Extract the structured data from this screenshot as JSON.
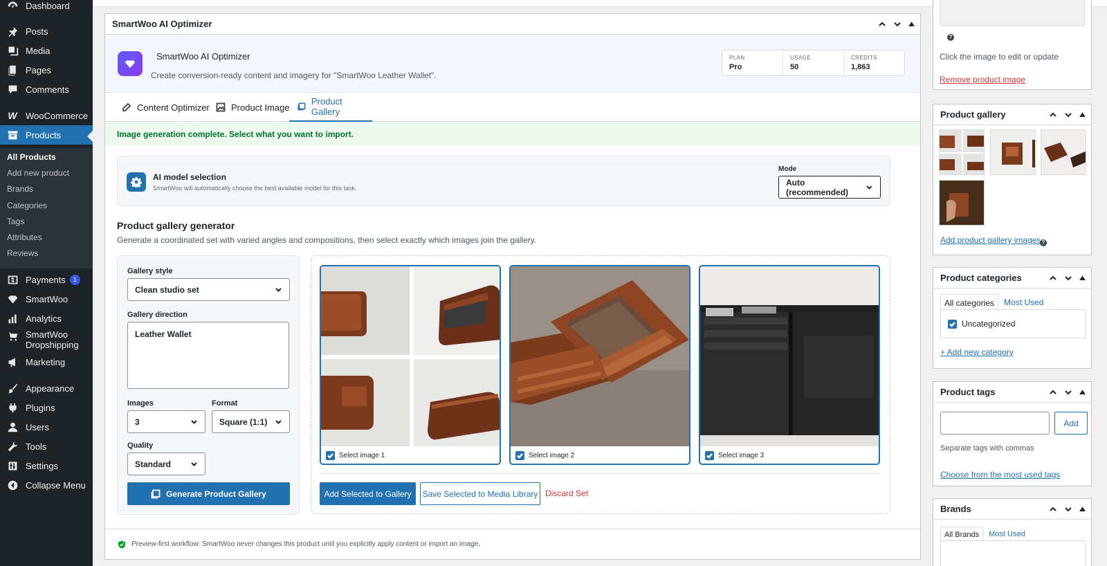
{
  "sidebar": {
    "items": [
      {
        "label": "Dashboard",
        "icon": "dashboard-icon"
      },
      {
        "label": "Posts",
        "icon": "pin-icon"
      },
      {
        "label": "Media",
        "icon": "media-icon"
      },
      {
        "label": "Pages",
        "icon": "pages-icon"
      },
      {
        "label": "Comments",
        "icon": "comment-icon"
      },
      {
        "label": "WooCommerce",
        "icon": "woo-icon"
      },
      {
        "label": "Products",
        "icon": "archive-icon"
      },
      {
        "label": "Payments",
        "icon": "dollar-icon"
      },
      {
        "label": "SmartWoo",
        "icon": "gem-icon"
      },
      {
        "label": "Analytics",
        "icon": "chart-icon"
      },
      {
        "label": "SmartWoo Dropshipping",
        "icon": "cart-icon"
      },
      {
        "label": "Marketing",
        "icon": "megaphone-icon"
      },
      {
        "label": "Appearance",
        "icon": "brush-icon"
      },
      {
        "label": "Plugins",
        "icon": "plug-icon"
      },
      {
        "label": "Users",
        "icon": "user-icon"
      },
      {
        "label": "Tools",
        "icon": "wrench-icon"
      },
      {
        "label": "Settings",
        "icon": "settings-icon"
      },
      {
        "label": "Collapse Menu",
        "icon": "collapse-icon"
      }
    ],
    "submenu": [
      "All Products",
      "Add new product",
      "Brands",
      "Categories",
      "Tags",
      "Attributes",
      "Reviews"
    ],
    "payments_badge": "1"
  },
  "panel": {
    "title": "SmartWoo AI Optimizer",
    "hero_title": "SmartWoo AI Optimizer",
    "hero_sub": "Create conversion-ready content and imagery for \"SmartWoo Leather Wallet\".",
    "stats": [
      {
        "label": "PLAN",
        "value": "Pro"
      },
      {
        "label": "USAGE",
        "value": "50"
      },
      {
        "label": "CREDITS",
        "value": "1,863"
      }
    ],
    "tabs": [
      "Content Optimizer",
      "Product Image",
      "Product Gallery"
    ],
    "notice": "Image generation complete. Select what you want to import.",
    "model_title": "AI model selection",
    "model_sub": "SmartWoo will automatically choose the best available model for this task.",
    "mode_label": "Mode",
    "mode_value": "Auto (recommended)",
    "gen_title": "Product gallery generator",
    "gen_sub": "Generate a coordinated set with varied angles and compositions, then select exactly which images join the gallery.",
    "form": {
      "style_label": "Gallery style",
      "style_value": "Clean studio set",
      "direction_label": "Gallery direction",
      "direction_value": "Leather Wallet",
      "images_label": "Images",
      "images_value": "3",
      "format_label": "Format",
      "format_value": "Square (1:1)",
      "quality_label": "Quality",
      "quality_value": "Standard",
      "generate_label": "Generate Product Gallery"
    },
    "cards": [
      "Select image 1",
      "Select image 2",
      "Select image 3"
    ],
    "actions": {
      "add": "Add Selected to Gallery",
      "save": "Save Selected to Media Library",
      "discard": "Discard Set"
    },
    "footer": "Preview-first workflow: SmartWoo never changes this product until you explicitly apply content or import an image."
  },
  "right": {
    "image_help": "Click the image to edit or update",
    "remove_image": "Remove product image",
    "gallery_title": "Product gallery",
    "add_gallery": "Add product gallery images",
    "categories_title": "Product categories",
    "cat_tab_all": "All categories",
    "cat_tab_used": "Most Used",
    "cat_item": "Uncategorized",
    "add_category": "+ Add new category",
    "tags_title": "Product tags",
    "tags_add": "Add",
    "tags_help": "Separate tags with commas",
    "tags_choose": "Choose from the most used tags",
    "brands_title": "Brands",
    "brands_tab_all": "All Brands",
    "brands_tab_used": "Most Used"
  },
  "colors": {
    "accent": "#2271b1",
    "sidebar": "#1d2327",
    "success": "#00752a",
    "danger": "#d63638"
  }
}
